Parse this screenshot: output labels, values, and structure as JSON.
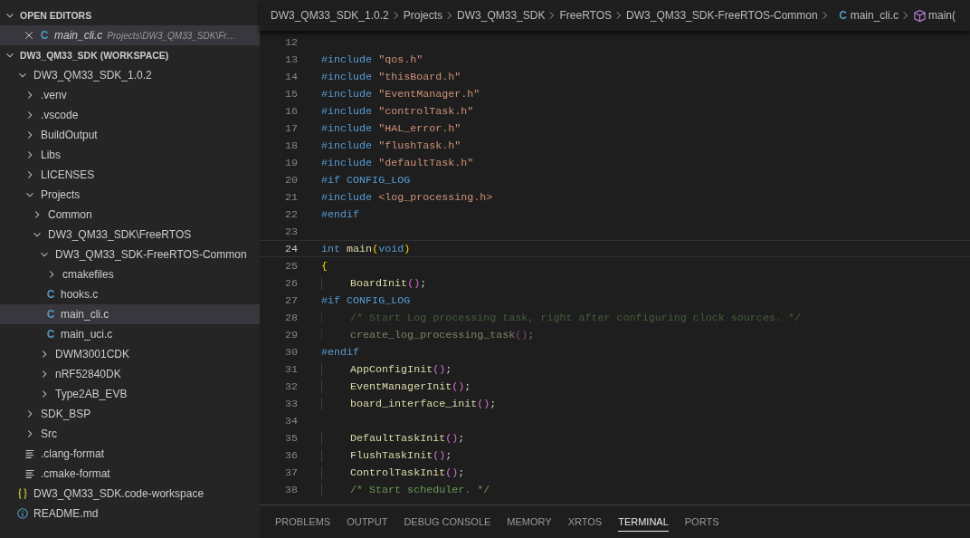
{
  "sidebar": {
    "open_editors": {
      "title": "OPEN EDITORS",
      "expanded": true,
      "items": [
        {
          "name": "main_cli.c",
          "path": "Projects\\DW3_QM33_SDK\\Fr…",
          "kind": "c",
          "icon": "C",
          "selected": true
        }
      ]
    },
    "workspace": {
      "title": "DW3_QM33_SDK (WORKSPACE)",
      "expanded": true,
      "tree": [
        {
          "name": "DW3_QM33_SDK_1.0.2",
          "kind": "folder",
          "expanded": true,
          "selected": false,
          "children": [
            {
              "name": ".venv",
              "kind": "folder",
              "expanded": false,
              "selected": false
            },
            {
              "name": ".vscode",
              "kind": "folder",
              "expanded": false,
              "selected": false
            },
            {
              "name": "BuildOutput",
              "kind": "folder",
              "expanded": false,
              "selected": false
            },
            {
              "name": "Libs",
              "kind": "folder",
              "expanded": false,
              "selected": false
            },
            {
              "name": "LICENSES",
              "kind": "folder",
              "expanded": false,
              "selected": false
            },
            {
              "name": "Projects",
              "kind": "folder",
              "expanded": true,
              "selected": false,
              "children": [
                {
                  "name": "Common",
                  "kind": "folder",
                  "expanded": false,
                  "selected": false
                },
                {
                  "name": "DW3_QM33_SDK\\FreeRTOS",
                  "kind": "folder",
                  "expanded": true,
                  "selected": false,
                  "children": [
                    {
                      "name": "DW3_QM33_SDK-FreeRTOS-Common",
                      "kind": "folder",
                      "expanded": true,
                      "selected": false,
                      "children": [
                        {
                          "name": "cmakefiles",
                          "kind": "folder",
                          "expanded": false,
                          "selected": false
                        },
                        {
                          "name": "hooks.c",
                          "kind": "c",
                          "icon": "C",
                          "selected": false
                        },
                        {
                          "name": "main_cli.c",
                          "kind": "c",
                          "icon": "C",
                          "selected": true
                        },
                        {
                          "name": "main_uci.c",
                          "kind": "c",
                          "icon": "C",
                          "selected": false
                        }
                      ]
                    },
                    {
                      "name": "DWM3001CDK",
                      "kind": "folder",
                      "expanded": false,
                      "selected": false
                    },
                    {
                      "name": "nRF52840DK",
                      "kind": "folder",
                      "expanded": false,
                      "selected": false
                    },
                    {
                      "name": "Type2AB_EVB",
                      "kind": "folder",
                      "expanded": false,
                      "selected": false
                    }
                  ]
                }
              ]
            },
            {
              "name": "SDK_BSP",
              "kind": "folder",
              "expanded": false,
              "selected": false
            },
            {
              "name": "Src",
              "kind": "folder",
              "expanded": false,
              "selected": false
            },
            {
              "name": ".clang-format",
              "kind": "text",
              "selected": false
            },
            {
              "name": ".cmake-format",
              "kind": "text",
              "selected": false
            }
          ]
        },
        {
          "name": "DW3_QM33_SDK.code-workspace",
          "kind": "json",
          "selected": false
        },
        {
          "name": "README.md",
          "kind": "info",
          "selected": false
        }
      ]
    }
  },
  "breadcrumbs": [
    {
      "label": "DW3_QM33_SDK_1.0.2",
      "kind": "folder"
    },
    {
      "label": "Projects",
      "kind": "folder"
    },
    {
      "label": "DW3_QM33_SDK",
      "kind": "folder"
    },
    {
      "label": "FreeRTOS",
      "kind": "folder"
    },
    {
      "label": "DW3_QM33_SDK-FreeRTOS-Common",
      "kind": "folder"
    },
    {
      "label": "main_cli.c",
      "kind": "c",
      "icon": "C"
    },
    {
      "label": "main(",
      "kind": "symbol"
    }
  ],
  "code": [
    {
      "n": "12",
      "current": false
    },
    {
      "n": "13",
      "current": false,
      "inactive": false,
      "tokens": [
        {
          "text": "#include ",
          "kind": "kw"
        },
        {
          "text": "\"qos.h\"",
          "kind": "str"
        }
      ]
    },
    {
      "n": "14",
      "current": false,
      "inactive": false,
      "tokens": [
        {
          "text": "#include ",
          "kind": "kw"
        },
        {
          "text": "\"thisBoard.h\"",
          "kind": "str"
        }
      ]
    },
    {
      "n": "15",
      "current": false,
      "inactive": false,
      "tokens": [
        {
          "text": "#include ",
          "kind": "kw"
        },
        {
          "text": "\"EventManager.h\"",
          "kind": "str"
        }
      ]
    },
    {
      "n": "16",
      "current": false,
      "inactive": false,
      "tokens": [
        {
          "text": "#include ",
          "kind": "kw"
        },
        {
          "text": "\"controlTask.h\"",
          "kind": "str"
        }
      ]
    },
    {
      "n": "17",
      "current": false,
      "inactive": false,
      "tokens": [
        {
          "text": "#include ",
          "kind": "kw"
        },
        {
          "text": "\"HAL_error.h\"",
          "kind": "str"
        }
      ]
    },
    {
      "n": "18",
      "current": false,
      "inactive": false,
      "tokens": [
        {
          "text": "#include ",
          "kind": "kw"
        },
        {
          "text": "\"flushTask.h\"",
          "kind": "str"
        }
      ]
    },
    {
      "n": "19",
      "current": false,
      "inactive": false,
      "tokens": [
        {
          "text": "#include ",
          "kind": "kw"
        },
        {
          "text": "\"defaultTask.h\"",
          "kind": "str"
        }
      ]
    },
    {
      "n": "20",
      "current": false,
      "inactive": false,
      "tokens": [
        {
          "text": "#if ",
          "kind": "kw"
        },
        {
          "text": "CONFIG_LOG",
          "kind": "macro"
        }
      ]
    },
    {
      "n": "21",
      "current": false,
      "inactive": false,
      "tokens": [
        {
          "text": "#include ",
          "kind": "kw"
        },
        {
          "text": "<log_processing.h>",
          "kind": "str"
        }
      ]
    },
    {
      "n": "22",
      "current": false,
      "inactive": false,
      "tokens": [
        {
          "text": "#endif",
          "kind": "kw"
        }
      ]
    },
    {
      "n": "23",
      "current": false
    },
    {
      "n": "24",
      "current": true,
      "inactive": false,
      "tokens": [
        {
          "text": "int ",
          "kind": "kw"
        },
        {
          "text": "main",
          "kind": "fn"
        },
        {
          "text": "(",
          "kind": "p1"
        },
        {
          "text": "void",
          "kind": "kw"
        },
        {
          "text": ")",
          "kind": "p1"
        }
      ]
    },
    {
      "n": "25",
      "current": false,
      "inactive": false,
      "tokens": [
        {
          "text": "{",
          "kind": "p1"
        }
      ]
    },
    {
      "n": "26",
      "current": false,
      "inactive": false,
      "indent": true,
      "tokens": [
        {
          "text": "BoardInit",
          "kind": "fn"
        },
        {
          "text": "()",
          "kind": "p2"
        },
        {
          "text": ";",
          "kind": "plain"
        }
      ]
    },
    {
      "n": "27",
      "current": false,
      "inactive": false,
      "tokens": [
        {
          "text": "#if ",
          "kind": "kw"
        },
        {
          "text": "CONFIG_LOG",
          "kind": "macro"
        }
      ]
    },
    {
      "n": "28",
      "current": false,
      "inactive": true,
      "indent": true,
      "tokens": [
        {
          "text": "/* Start Log processing task, right after configuring clock sources. */",
          "kind": "comment"
        }
      ]
    },
    {
      "n": "29",
      "current": false,
      "inactive": true,
      "indent": true,
      "tokens": [
        {
          "text": "create_log_processing_task",
          "kind": "fn"
        },
        {
          "text": "()",
          "kind": "p2"
        },
        {
          "text": ";",
          "kind": "plain"
        }
      ]
    },
    {
      "n": "30",
      "current": false,
      "inactive": false,
      "tokens": [
        {
          "text": "#endif",
          "kind": "kw"
        }
      ]
    },
    {
      "n": "31",
      "current": false,
      "inactive": false,
      "indent": true,
      "tokens": [
        {
          "text": "AppConfigInit",
          "kind": "fn"
        },
        {
          "text": "()",
          "kind": "p2"
        },
        {
          "text": ";",
          "kind": "plain"
        }
      ]
    },
    {
      "n": "32",
      "current": false,
      "inactive": false,
      "indent": true,
      "tokens": [
        {
          "text": "EventManagerInit",
          "kind": "fn"
        },
        {
          "text": "()",
          "kind": "p2"
        },
        {
          "text": ";",
          "kind": "plain"
        }
      ]
    },
    {
      "n": "33",
      "current": false,
      "inactive": false,
      "indent": true,
      "tokens": [
        {
          "text": "board_interface_init",
          "kind": "fn"
        },
        {
          "text": "()",
          "kind": "p2"
        },
        {
          "text": ";",
          "kind": "plain"
        }
      ]
    },
    {
      "n": "34",
      "current": false
    },
    {
      "n": "35",
      "current": false,
      "inactive": false,
      "indent": true,
      "tokens": [
        {
          "text": "DefaultTaskInit",
          "kind": "fn"
        },
        {
          "text": "()",
          "kind": "p2"
        },
        {
          "text": ";",
          "kind": "plain"
        }
      ]
    },
    {
      "n": "36",
      "current": false,
      "inactive": false,
      "indent": true,
      "tokens": [
        {
          "text": "FlushTaskInit",
          "kind": "fn"
        },
        {
          "text": "()",
          "kind": "p2"
        },
        {
          "text": ";",
          "kind": "plain"
        }
      ]
    },
    {
      "n": "37",
      "current": false,
      "inactive": false,
      "indent": true,
      "tokens": [
        {
          "text": "ControlTaskInit",
          "kind": "fn"
        },
        {
          "text": "()",
          "kind": "p2"
        },
        {
          "text": ";",
          "kind": "plain"
        }
      ]
    },
    {
      "n": "38",
      "current": false,
      "inactive": false,
      "indent": true,
      "tokens": [
        {
          "text": "/* Start scheduler. */",
          "kind": "comment"
        }
      ]
    }
  ],
  "panel_tabs": [
    {
      "label": "PROBLEMS",
      "selected": false
    },
    {
      "label": "OUTPUT",
      "selected": false
    },
    {
      "label": "DEBUG CONSOLE",
      "selected": false
    },
    {
      "label": "MEMORY",
      "selected": false
    },
    {
      "label": "XRTOS",
      "selected": false
    },
    {
      "label": "TERMINAL",
      "selected": true
    },
    {
      "label": "PORTS",
      "selected": false
    }
  ]
}
